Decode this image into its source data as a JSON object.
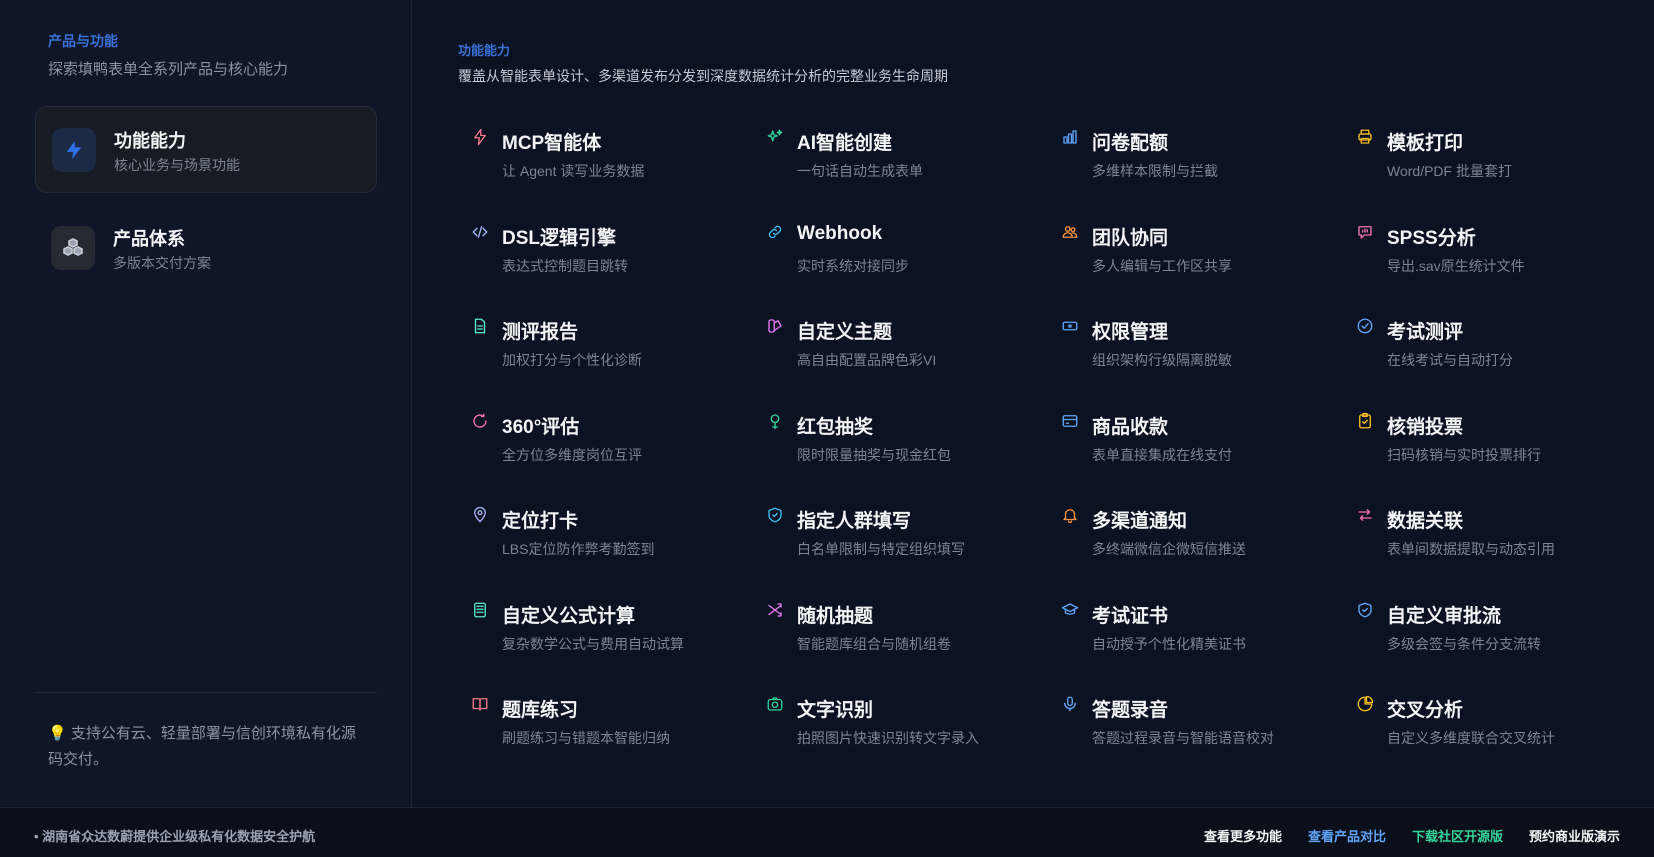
{
  "sidebar": {
    "eyebrow": "产品与功能",
    "subtitle": "探索填鸭表单全系列产品与核心能力",
    "nav": [
      {
        "title": "功能能力",
        "desc": "核心业务与场景功能",
        "icon": "lightning-icon",
        "active": true
      },
      {
        "title": "产品体系",
        "desc": "多版本交付方案",
        "icon": "cubes-icon",
        "active": false
      }
    ],
    "note_icon": "💡",
    "note": "支持公有云、轻量部署与信创环境私有化源码交付。"
  },
  "main": {
    "eyebrow": "功能能力",
    "subtitle": "覆盖从智能表单设计、多渠道发布分发到深度数据统计分析的完整业务生命周期",
    "features": [
      {
        "title": "MCP智能体",
        "desc": "让 Agent 读写业务数据",
        "icon": "bolt-icon",
        "color": "#f07a8c"
      },
      {
        "title": "AI智能创建",
        "desc": "一句话自动生成表单",
        "icon": "sparkles-icon",
        "color": "#34d399"
      },
      {
        "title": "问卷配额",
        "desc": "多维样本限制与拦截",
        "icon": "bar-chart-icon",
        "color": "#60a5fa"
      },
      {
        "title": "模板打印",
        "desc": "Word/PDF 批量套打",
        "icon": "printer-icon",
        "color": "#fbbf24"
      },
      {
        "title": "DSL逻辑引擎",
        "desc": "表达式控制题目跳转",
        "icon": "code-icon",
        "color": "#a5b4fc"
      },
      {
        "title": "Webhook",
        "desc": "实时系统对接同步",
        "icon": "link-icon",
        "color": "#38bdf8"
      },
      {
        "title": "团队协同",
        "desc": "多人编辑与工作区共享",
        "icon": "users-icon",
        "color": "#fb923c"
      },
      {
        "title": "SPSS分析",
        "desc": "导出.sav原生统计文件",
        "icon": "chat-chart-icon",
        "color": "#f472b6"
      },
      {
        "title": "测评报告",
        "desc": "加权打分与个性化诊断",
        "icon": "document-icon",
        "color": "#5eead4"
      },
      {
        "title": "自定义主题",
        "desc": "高自由配置品牌色彩VI",
        "icon": "palette-icon",
        "color": "#e879f9"
      },
      {
        "title": "权限管理",
        "desc": "组织架构行级隔离脱敏",
        "icon": "key-card-icon",
        "color": "#60a5fa"
      },
      {
        "title": "考试测评",
        "desc": "在线考试与自动打分",
        "icon": "check-circle-icon",
        "color": "#60a5fa"
      },
      {
        "title": "360°评估",
        "desc": "全方位多维度岗位互评",
        "icon": "refresh-icon",
        "color": "#f472b6"
      },
      {
        "title": "红包抽奖",
        "desc": "限时限量抽奖与现金红包",
        "icon": "gift-icon",
        "color": "#34d399"
      },
      {
        "title": "商品收款",
        "desc": "表单直接集成在线支付",
        "icon": "credit-card-icon",
        "color": "#60a5fa"
      },
      {
        "title": "核销投票",
        "desc": "扫码核销与实时投票排行",
        "icon": "clipboard-check-icon",
        "color": "#fbbf24"
      },
      {
        "title": "定位打卡",
        "desc": "LBS定位防作弊考勤签到",
        "icon": "map-pin-icon",
        "color": "#a5b4fc"
      },
      {
        "title": "指定人群填写",
        "desc": "白名单限制与特定组织填写",
        "icon": "shield-check-icon",
        "color": "#38bdf8"
      },
      {
        "title": "多渠道通知",
        "desc": "多终端微信企微短信推送",
        "icon": "bell-icon",
        "color": "#fb923c"
      },
      {
        "title": "数据关联",
        "desc": "表单间数据提取与动态引用",
        "icon": "arrows-icon",
        "color": "#f472b6"
      },
      {
        "title": "自定义公式计算",
        "desc": "复杂数学公式与费用自动试算",
        "icon": "calculator-icon",
        "color": "#5eead4"
      },
      {
        "title": "随机抽题",
        "desc": "智能题库组合与随机组卷",
        "icon": "shuffle-icon",
        "color": "#e879f9"
      },
      {
        "title": "考试证书",
        "desc": "自动授予个性化精美证书",
        "icon": "graduation-cap-icon",
        "color": "#60a5fa"
      },
      {
        "title": "自定义审批流",
        "desc": "多级会签与条件分支流转",
        "icon": "shield-check-icon",
        "color": "#60a5fa"
      },
      {
        "title": "题库练习",
        "desc": "刷题练习与错题本智能归纳",
        "icon": "book-icon",
        "color": "#f07a8c"
      },
      {
        "title": "文字识别",
        "desc": "拍照图片快速识别转文字录入",
        "icon": "camera-icon",
        "color": "#34d399"
      },
      {
        "title": "答题录音",
        "desc": "答题过程录音与智能语音校对",
        "icon": "microphone-icon",
        "color": "#60a5fa"
      },
      {
        "title": "交叉分析",
        "desc": "自定义多维度联合交叉统计",
        "icon": "pie-chart-icon",
        "color": "#fbbf24"
      }
    ]
  },
  "footer": {
    "left": "• 湖南省众达数蔚提供企业级私有化数据安全护航",
    "links": [
      {
        "label": "查看更多功能",
        "color": "#f3f4f6"
      },
      {
        "label": "查看产品对比",
        "color": "#60a5fa"
      },
      {
        "label": "下载社区开源版",
        "color": "#34d399"
      },
      {
        "label": "预约商业版演示",
        "color": "#f3f4f6"
      }
    ]
  }
}
